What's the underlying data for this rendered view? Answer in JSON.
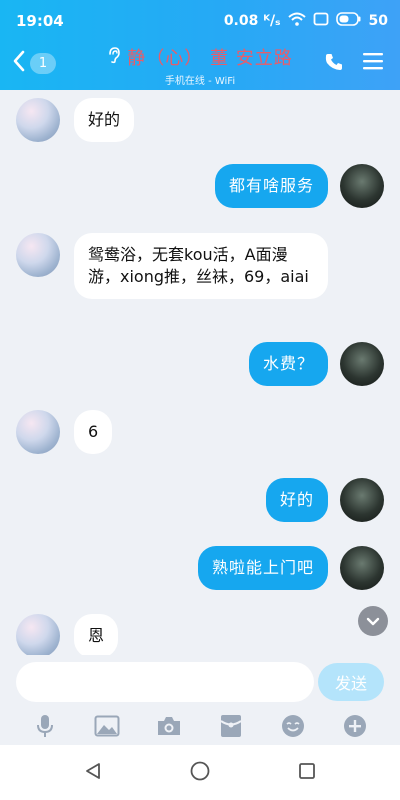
{
  "status_bar": {
    "time": "19:04",
    "network_speed": "0.08 ᴷ/ₛ",
    "battery": "50"
  },
  "title_bar": {
    "back_badge": "1",
    "title": "静（心） 董 安立路",
    "subtitle": "手机在线 - WiFi"
  },
  "messages": [
    {
      "side": "in",
      "text": "好的"
    },
    {
      "side": "out",
      "text": "都有啥服务"
    },
    {
      "side": "in",
      "text": "鸳鸯浴，无套kou活，A面漫游，xiong推，丝袜，69，aiai"
    },
    {
      "side": "out",
      "text": "水费？"
    },
    {
      "side": "in",
      "text": "6"
    },
    {
      "side": "out",
      "text": "好的"
    },
    {
      "side": "out",
      "text": "熟啦能上门吧"
    },
    {
      "side": "in",
      "text": "恩"
    }
  ],
  "input": {
    "value": "",
    "placeholder": "",
    "send_label": "发送"
  },
  "toolbar_icons": [
    "microphone-icon",
    "image-icon",
    "camera-icon",
    "red-packet-icon",
    "emoji-icon",
    "plus-icon"
  ],
  "colors": {
    "header_gradient_start": "#19b6f3",
    "header_gradient_end": "#3ea2f7",
    "outgoing_bubble": "#16a7ef",
    "incoming_bubble": "#ffffff",
    "title_text": "#e85d6a",
    "send_button": "#b4e4fb",
    "chat_background": "#eef1f6"
  }
}
